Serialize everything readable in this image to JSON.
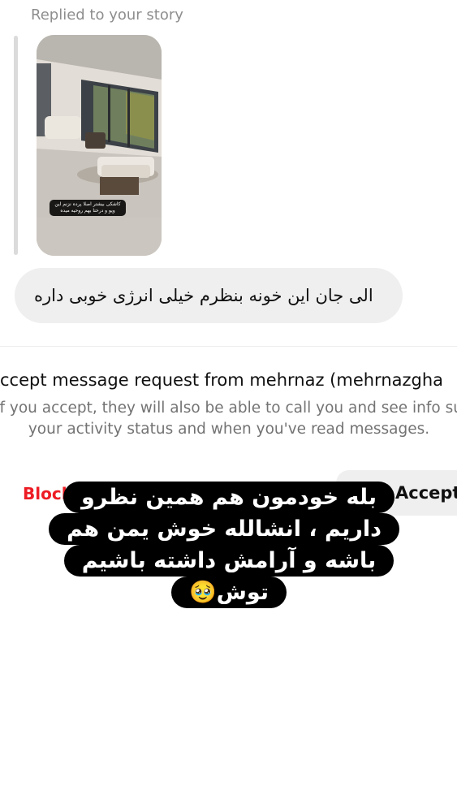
{
  "reply_header": "Replied to your story",
  "story": {
    "caption": "کاشکی بیشتر اصلا پرده نزنم این ویو و درختا بهم روحیه میده"
  },
  "message": {
    "text": "الی جان این خونه بنظرم خیلی انرژی خوبی داره"
  },
  "request": {
    "title": "Accept message request from mehrnaz (mehrnazgha",
    "info_line1": "If you accept, they will also be able to call you and see info su",
    "info_line2": "your activity status and when you've read messages."
  },
  "actions": {
    "block_label": "Block",
    "accept_label": "Accept"
  },
  "story_overlay_text": "بله خودمون هم همین نظرو داریم ، انشالله خوش یمن هم باشه و آرامش داشته باشیم توش🥹"
}
